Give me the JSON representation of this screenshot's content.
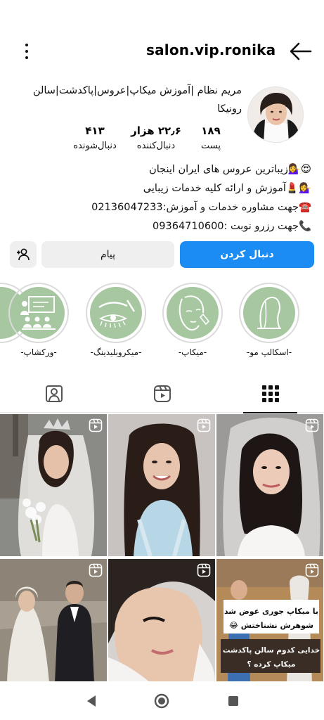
{
  "profile": {
    "username": "salon.vip.ronika",
    "name_line1": "مریم نظام |آموزش میکاپ|عروس|پاکدشت|سالن",
    "name_line2": "رونیکا"
  },
  "stats": {
    "posts": {
      "value": "۱۸۹",
      "label": "پست"
    },
    "followers": {
      "value": "۲۲٫۶ هزار",
      "label": "دنبال‌کننده"
    },
    "following": {
      "value": "۴۱۳",
      "label": "دنبال‌شونده"
    }
  },
  "bio": {
    "line1": "😍💁‍♀️زیباترین عروس های ایران اینجان",
    "line2": "💁‍♀️💄آموزش و ارائه کلیه خدمات زیبایی",
    "line3": "☎️جهت مشاوره خدمات و آموزش:02136047233",
    "line4": "📞جهت رزرو نوبت :09364710600"
  },
  "buttons": {
    "follow": "دنبال کردن",
    "message": "پیام"
  },
  "highlights": [
    {
      "label": "-اسکالپ مو-"
    },
    {
      "label": "-میکاپ-"
    },
    {
      "label": "-میکروبلیدینگ-"
    },
    {
      "label": "-ورکشاپ-"
    }
  ],
  "posts": {
    "post6_caption_line1": "با میکاپ جوری عوض شد",
    "post6_caption_line2": "شوهرش نشناختش 😂",
    "post6_caption_line3": "خدایی کدوم سالن پاکدشت",
    "post6_caption_line4": "میکاپ کرده ؟"
  },
  "colors": {
    "accent": "#1a8cf3",
    "highlight_bg": "#a6c7a0",
    "secondary_button": "#efefef"
  }
}
